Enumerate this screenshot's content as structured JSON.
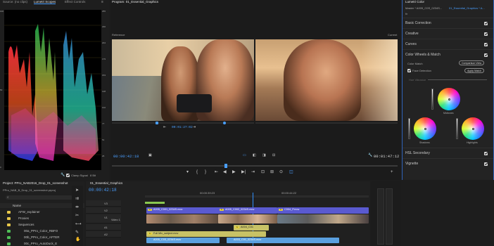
{
  "scopes": {
    "tabs": [
      "Source: (no clips)",
      "Lumetri Scopes",
      "Effect Controls"
    ],
    "scale_right": [
      "255",
      "230",
      "204",
      "179",
      "153",
      "128",
      "102",
      "77",
      "51",
      "26"
    ],
    "scale_left": [
      "100",
      "90",
      "80",
      "70",
      "60",
      "50",
      "40",
      "30",
      "20",
      "10",
      "0"
    ],
    "clamp_label": "Clamp Signal",
    "bit_depth": "8 Bit"
  },
  "program": {
    "title": "Program: 01_Essential_Graphics",
    "reference_label": "Reference",
    "current_label": "Current",
    "ref_timecode": "00:01:27:02",
    "timecode_left": "00:00:42:18",
    "timecode_right": "00:01:47:12"
  },
  "lumetri": {
    "tab": "Lumetri Color",
    "master_label": "Master * A005_C0S_0234S...",
    "sequence_label": "01_Essential_Graphics * A...",
    "fx": "fx",
    "sections": [
      "Basic Correction",
      "Creative",
      "Curves",
      "Color Wheels & Match"
    ],
    "color_match": "Color Match",
    "comparison_view": "Comparison View",
    "face_detection": "Face Detection",
    "apply_match": "Apply Match",
    "hue_label": "Hue Vibrance",
    "wheels": [
      "Midtones",
      "Shadows",
      "Highlights"
    ],
    "hsl": "HSL Secondary",
    "vignette": "Vignette"
  },
  "project": {
    "tab": "Project: PPro_NAB2016_Drop_01_screenshot",
    "path": "PPro_NAB_B_Drop_01_screenshot.prproj",
    "name_header": "Name",
    "items": [
      {
        "name": "AFW_explainer",
        "color": "#e8c84a"
      },
      {
        "name": "Proxies",
        "color": "#e8c84a"
      },
      {
        "name": "Sequences",
        "color": "#e8c84a"
      },
      {
        "name": "00a_PPro_Color_RBFO",
        "color": "#4fbf57"
      },
      {
        "name": "00b_PPro_Color_AFTER",
        "color": "#4fbf57"
      },
      {
        "name": "00c_PPro_AutoDuck_E",
        "color": "#4fbf57"
      }
    ]
  },
  "timeline": {
    "sequence": "01_Essential_Graphics",
    "timecode": "00:00:42:18",
    "ruler": [
      "00:00:39:23",
      "00:00:44:22"
    ],
    "tracks": [
      "V3",
      "V2",
      "V1",
      "A1",
      "A2"
    ],
    "video1_label": "Video 1",
    "clips": [
      {
        "label": "A005_C001_0234S.mov"
      },
      {
        "label": "A005_C002_0234S.mov"
      },
      {
        "label": "C004_P.mov"
      },
      {
        "label": "A004_C01"
      },
      {
        "label": "Full Mix_subject.mov"
      },
      {
        "label": "A005_C03_0234S.mov"
      },
      {
        "label": "A003_C01_0234S.mov"
      }
    ]
  },
  "colors": {
    "accent": "#4a9fff",
    "playhead": "#2f8fff",
    "video_clip": "#5aa0e0",
    "audio_clip": "#c8c266",
    "graphic_clip": "#5a7fd0"
  }
}
